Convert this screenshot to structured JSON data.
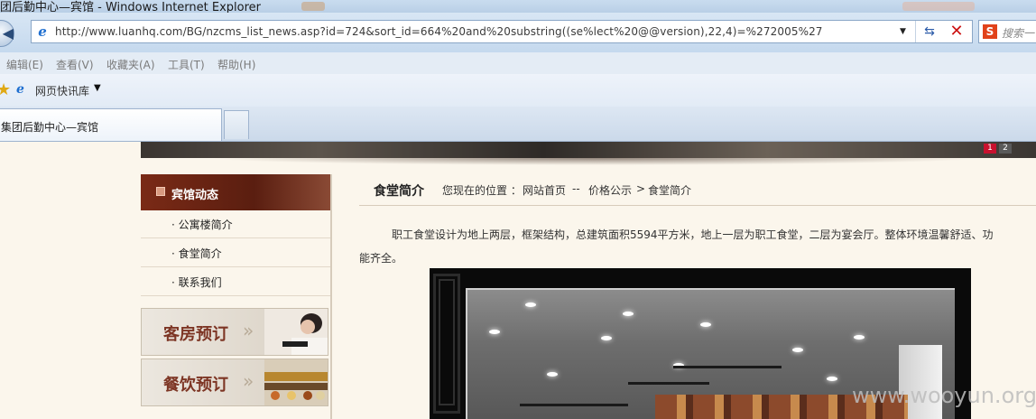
{
  "window": {
    "title": "团后勤中心—宾馆 - Windows Internet Explorer"
  },
  "address_bar": {
    "url": "http://www.luanhq.com/BG/nzcms_list_news.asp?id=724&sort_id=664%20and%20substring((se%lect%20@@version),22,4)=%272005%27"
  },
  "search_box": {
    "placeholder": "搜索一"
  },
  "menu": {
    "items": [
      "编辑(E)",
      "查看(V)",
      "收藏夹(A)",
      "工具(T)",
      "帮助(H)"
    ]
  },
  "favorites_bar": {
    "link_label": "网页快讯库"
  },
  "tabs": {
    "active_label": "集团后勤中心—宾馆"
  },
  "banner": {
    "slides": [
      "1",
      "2"
    ]
  },
  "sidebar": {
    "header": "宾馆动态",
    "items": [
      "· 公寓楼简介",
      "· 食堂简介",
      "· 联系我们"
    ],
    "promos": [
      "客房预订",
      "餐饮预订"
    ]
  },
  "content": {
    "title": "食堂简介",
    "breadcrumb": {
      "prefix": "您现在的位置 ：",
      "home": "网站首页",
      "sep1": "--",
      "section": "价格公示",
      "sep2": ">",
      "current": "食堂简介"
    },
    "paragraph_line1": "职工食堂设计为地上两层，框架结构，总建筑面积5594平方米，地上一层为职工食堂，二层为宴会厅。整体环境温馨舒适、功",
    "paragraph_line2": "能齐全。"
  },
  "watermark": "www.wooyun.org",
  "colors": {
    "sidebar_header": "#7a2a16",
    "page_bg": "#fbf6ec",
    "promo_text": "#7d3524",
    "slide_active": "#c8102e"
  }
}
